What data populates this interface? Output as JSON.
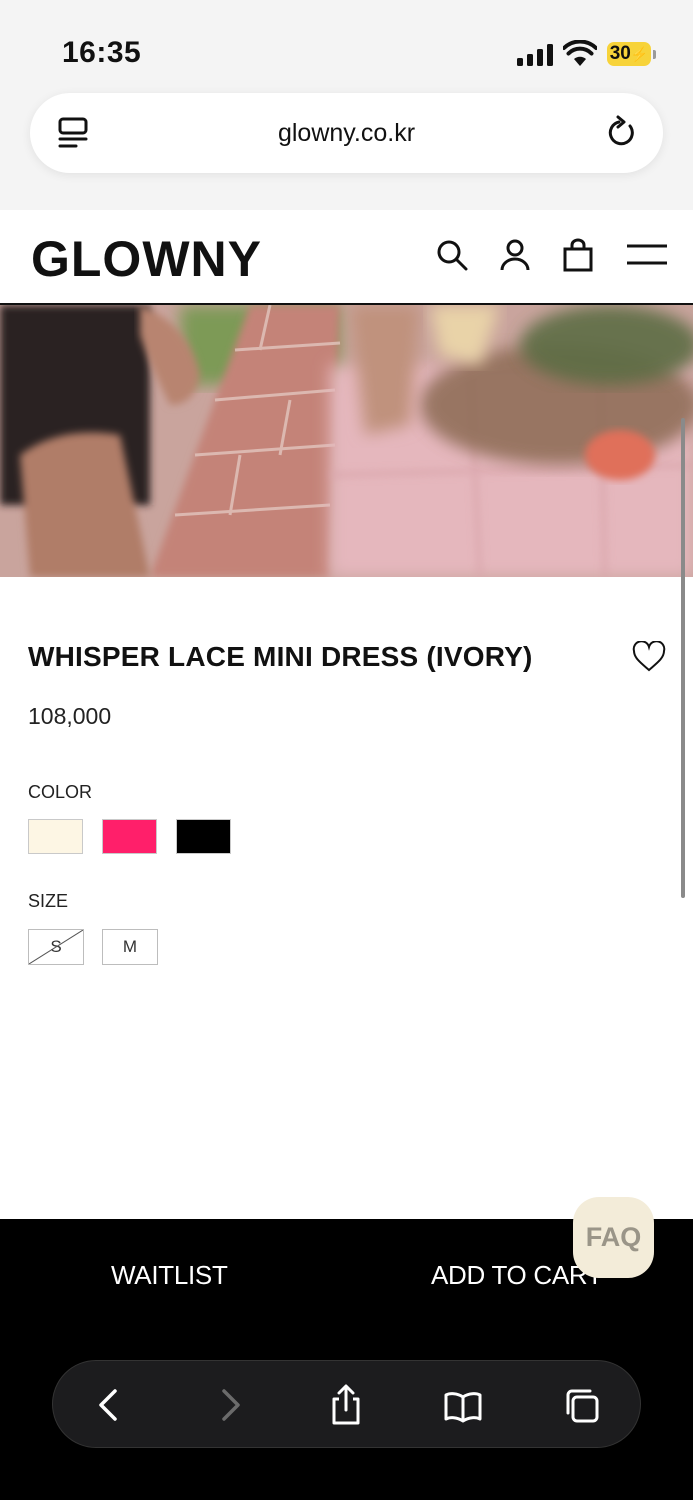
{
  "status_bar": {
    "time": "16:35",
    "battery": "30",
    "icons": [
      "signal-icon",
      "wifi-icon",
      "battery-icon"
    ]
  },
  "browser": {
    "url": "glowny.co.kr",
    "icons": [
      "reader-mode-icon",
      "reload-icon"
    ]
  },
  "site_header": {
    "logo": "GLOWNY",
    "icons": [
      "search-icon",
      "account-icon",
      "shopping-bag-icon",
      "menu-icon"
    ]
  },
  "product": {
    "title": "WHISPER LACE MINI DRESS (IVORY)",
    "price": "108,000",
    "color_label": "COLOR",
    "colors": [
      {
        "name": "ivory",
        "hex": "#fdf6e4"
      },
      {
        "name": "pink",
        "hex": "#ff1f6a"
      },
      {
        "name": "black",
        "hex": "#000000"
      }
    ],
    "size_label": "SIZE",
    "sizes": [
      {
        "label": "S",
        "sold_out": true
      },
      {
        "label": "M",
        "sold_out": false
      }
    ]
  },
  "actions": {
    "waitlist": "WAITLIST",
    "add_to_cart": "ADD TO CART",
    "faq": "FAQ"
  },
  "safari_toolbar": {
    "icons": [
      "back-icon",
      "forward-icon",
      "share-icon",
      "bookmarks-icon",
      "tabs-icon"
    ]
  }
}
